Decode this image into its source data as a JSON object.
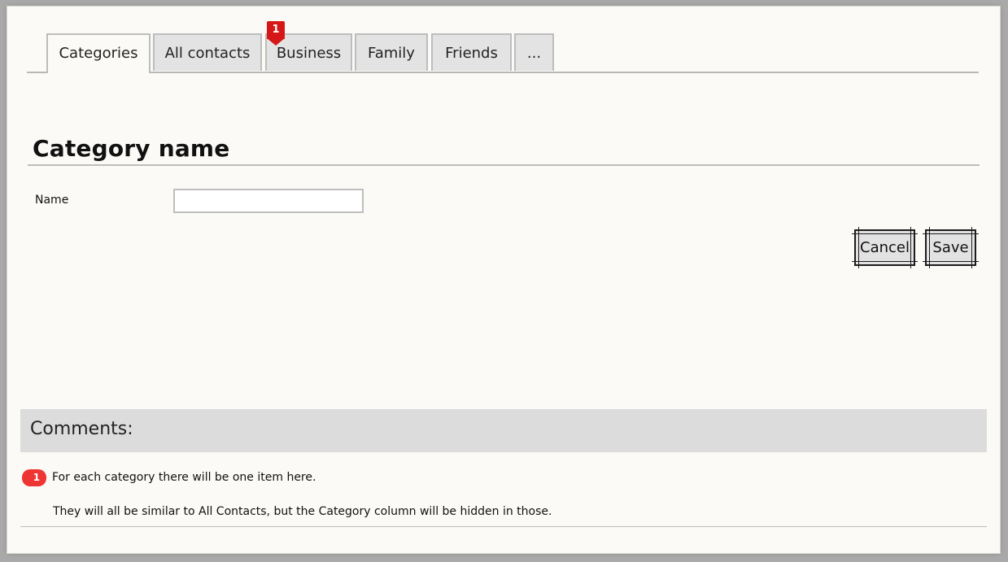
{
  "tabs": [
    {
      "label": "Categories",
      "active": true
    },
    {
      "label": "All contacts",
      "active": false
    },
    {
      "label": "Business",
      "active": false
    },
    {
      "label": "Family",
      "active": false
    },
    {
      "label": "Friends",
      "active": false
    },
    {
      "label": "...",
      "active": false
    }
  ],
  "tab_badge": "1",
  "section": {
    "title": "Category name"
  },
  "form": {
    "name_label": "Name",
    "name_value": "",
    "name_placeholder": ""
  },
  "buttons": {
    "cancel_label": "Cancel",
    "save_label": "Save"
  },
  "comments": {
    "title": "Comments:",
    "badge": "1",
    "line1": "For each category there will be one item here.",
    "line2": "They will all be similar to All Contacts, but the Category column will be hidden in those."
  },
  "colors": {
    "badge_red": "#d61717",
    "comment_badge_red": "#ef3434",
    "tab_inactive_bg": "#e3e3e3",
    "comments_header_bg": "#dcdcdc",
    "button_bg": "#e2e2e2",
    "paper_bg": "#fbfaf6"
  },
  "icons": {
    "tab_badge_icon": "red-pin-badge-icon"
  }
}
